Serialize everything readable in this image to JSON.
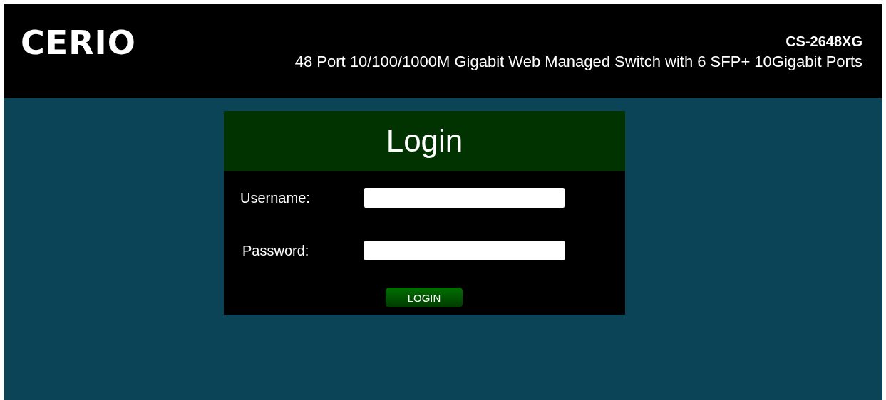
{
  "header": {
    "logo": "CERIO",
    "model": "CS-2648XG",
    "description": "48 Port 10/100/1000M Gigabit Web Managed Switch with 6 SFP+ 10Gigabit Ports"
  },
  "login": {
    "title": "Login",
    "fields": [
      {
        "label": "Username:",
        "kind": "text"
      },
      {
        "label": "Password:",
        "kind": "password"
      }
    ],
    "button": "LOGIN"
  }
}
